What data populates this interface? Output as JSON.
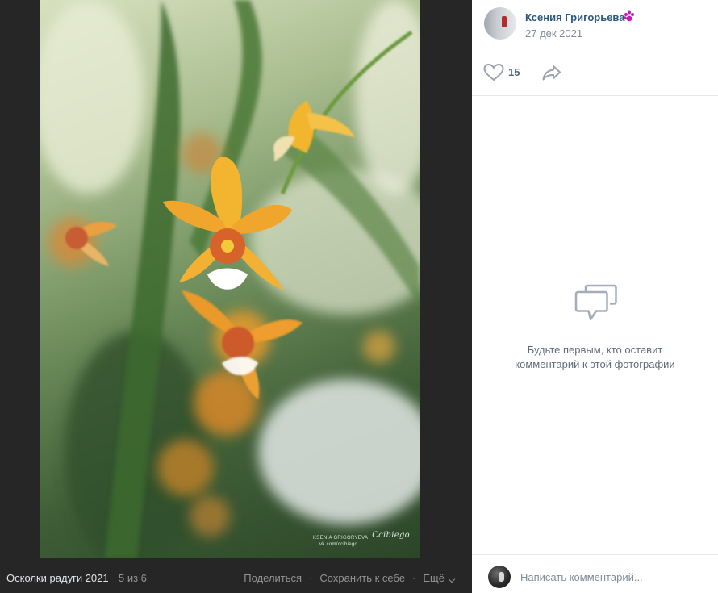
{
  "viewer": {
    "album_title": "Осколки радуги 2021",
    "counter": "5 из 6",
    "actions": {
      "share_label": "Поделиться",
      "save_label": "Сохранить к себе",
      "more_label": "Ещё"
    },
    "photo": {
      "subject": "orange-orchid-flowers",
      "watermark_line1": "KSENIA GRIGORYEVA",
      "watermark_line2": "vk.com/ccibiego",
      "watermark_signature": "Ccibiego"
    }
  },
  "sidebar": {
    "author": {
      "name": "Ксения Григорьева",
      "date": "27 дек 2021",
      "badge_icon": "paw-icon",
      "badge_color": "#c21dba"
    },
    "likes": {
      "count": "15",
      "like_icon": "heart-outline-icon",
      "share_icon": "share-arrow-icon"
    },
    "empty_comments": {
      "icon": "speech-bubbles-icon",
      "text": "Будьте первым, кто оставит комментарий к этой фотографии"
    },
    "composer": {
      "placeholder": "Написать комментарий..."
    }
  },
  "colors": {
    "link": "#2a5885",
    "secondary_text": "#818c99",
    "viewer_bg": "#262626",
    "icon_gray": "#99a2ad"
  }
}
